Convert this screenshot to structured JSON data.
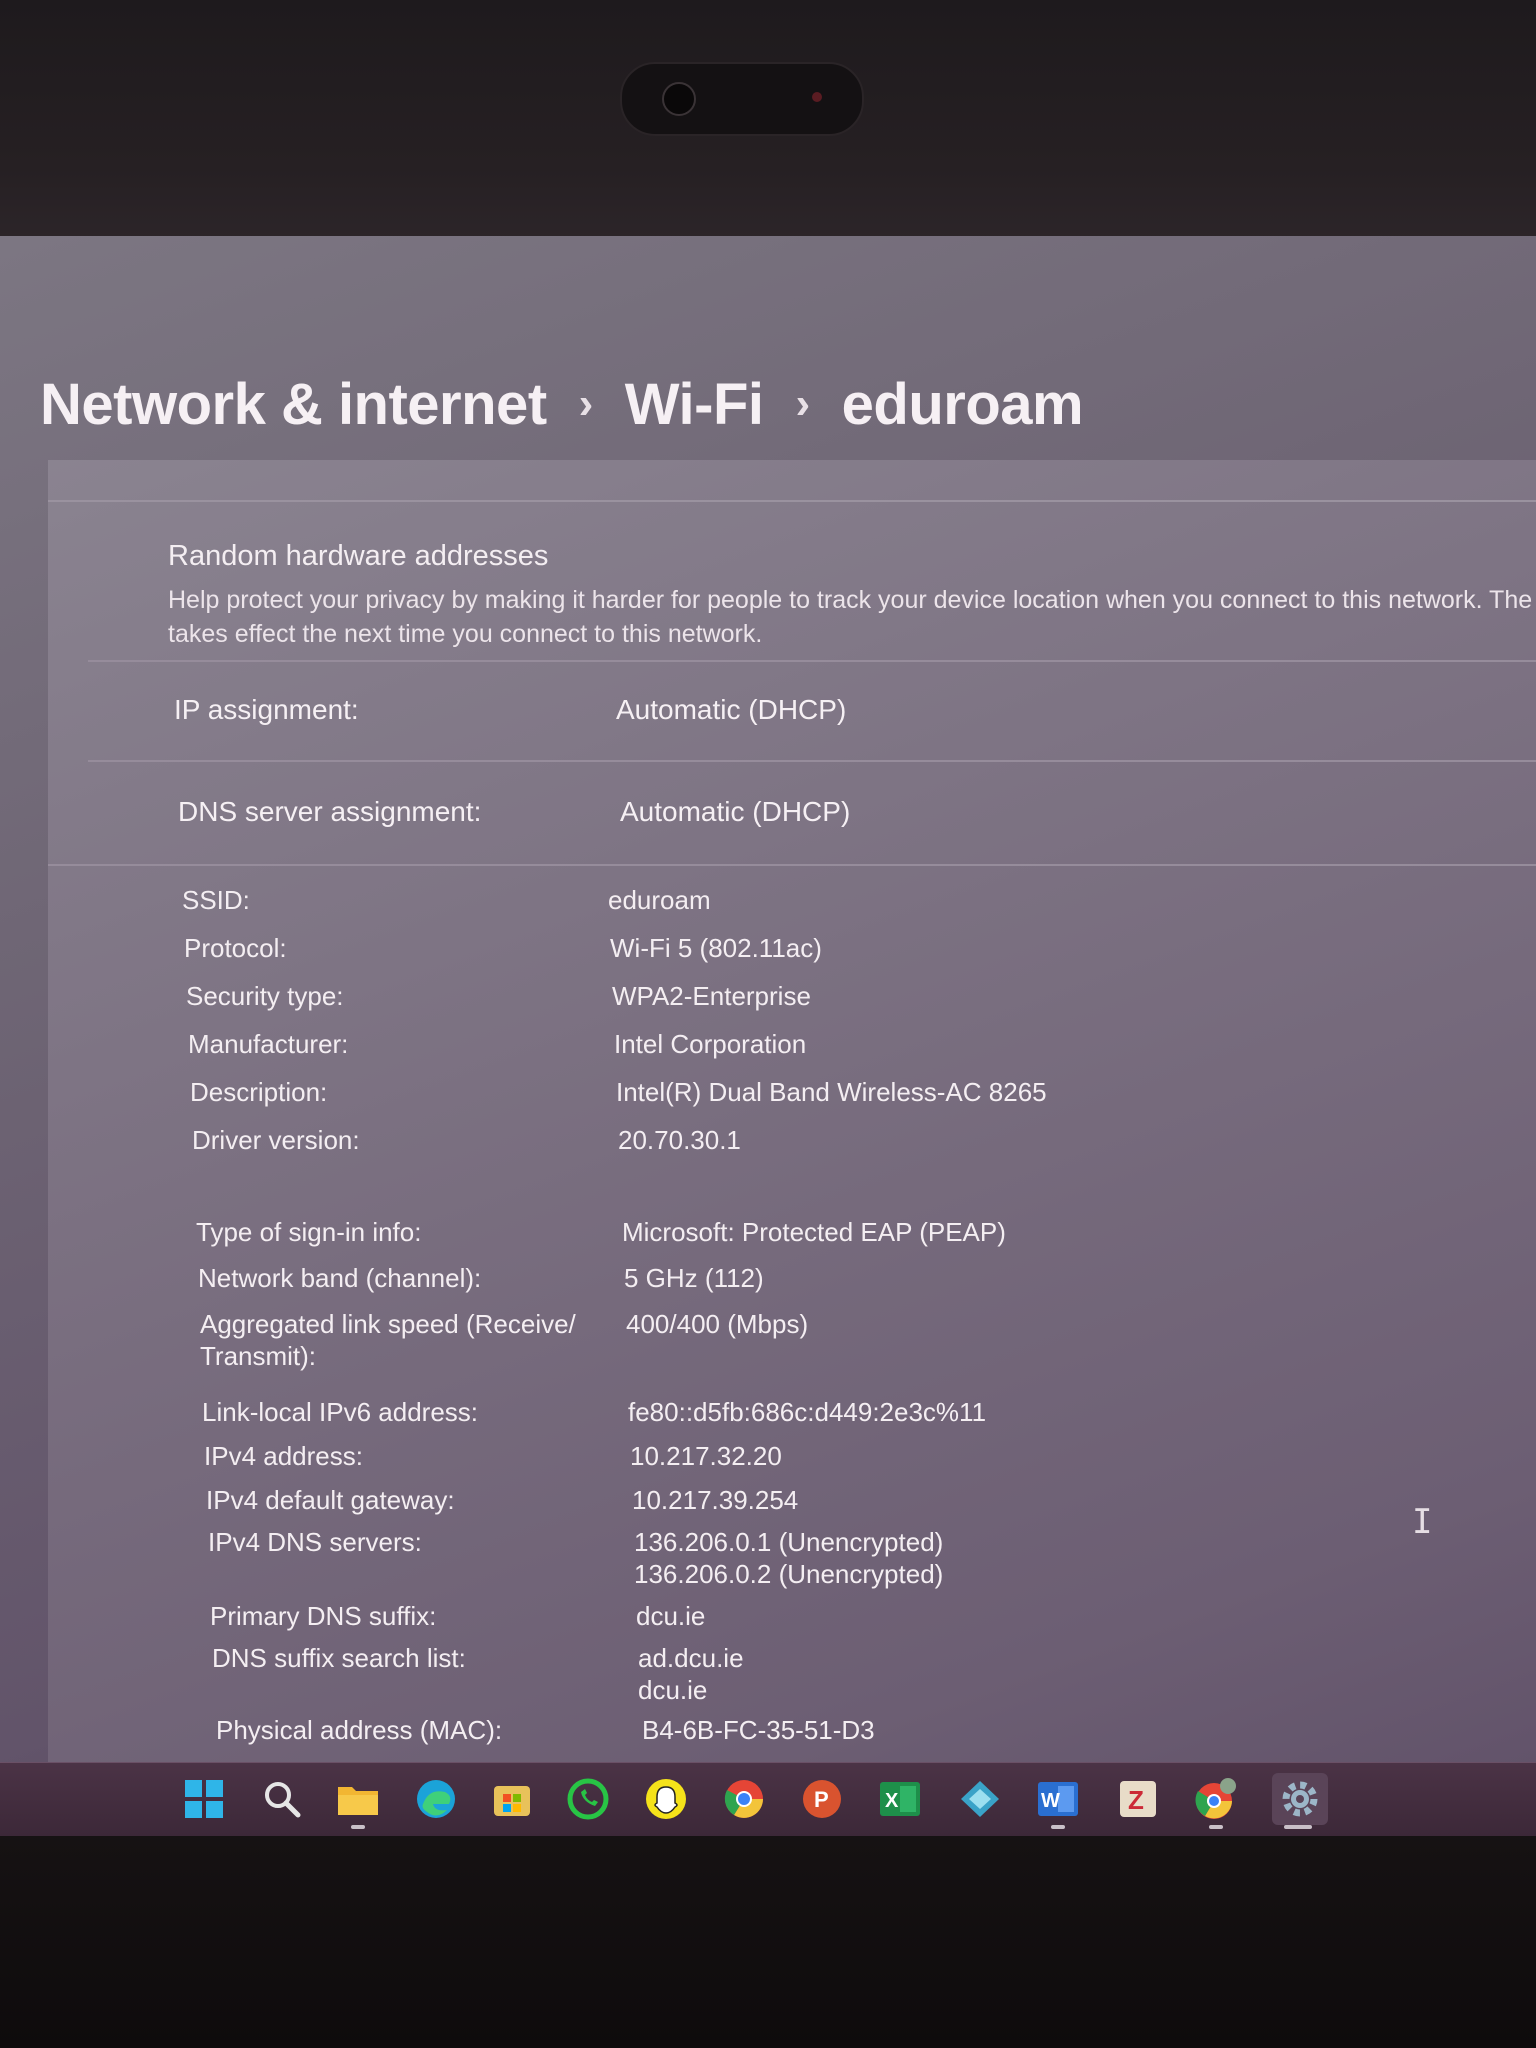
{
  "breadcrumb": {
    "level1": "Network & internet",
    "level2": "Wi-Fi",
    "current": "eduroam",
    "separator": "›"
  },
  "privacy": {
    "title": "Random hardware addresses",
    "description_line1": "Help protect your privacy by making it harder for people to track your device location when you connect to this network. The",
    "description_line2": "takes effect the next time you connect to this network."
  },
  "assignment": {
    "ip_label": "IP assignment:",
    "ip_value": "Automatic (DHCP)",
    "dns_label": "DNS server assignment:",
    "dns_value": "Automatic (DHCP)"
  },
  "properties": [
    {
      "label": "SSID:",
      "value": "eduroam"
    },
    {
      "label": "Protocol:",
      "value": "Wi-Fi 5 (802.11ac)"
    },
    {
      "label": "Security type:",
      "value": "WPA2-Enterprise"
    },
    {
      "label": "Manufacturer:",
      "value": "Intel Corporation"
    },
    {
      "label": "Description:",
      "value": "Intel(R) Dual Band Wireless-AC 8265"
    },
    {
      "label": "Driver version:",
      "value": "20.70.30.1"
    },
    {
      "label": "Type of sign-in info:",
      "value": "Microsoft: Protected EAP (PEAP)"
    },
    {
      "label": "Network band (channel):",
      "value": "5 GHz (112)"
    },
    {
      "label": "Aggregated link speed (Receive/",
      "label_line2": "Transmit):",
      "value": "400/400 (Mbps)"
    },
    {
      "label": "Link-local IPv6 address:",
      "value": "fe80::d5fb:686c:d449:2e3c%11"
    },
    {
      "label": "IPv4 address:",
      "value": "10.217.32.20"
    },
    {
      "label": "IPv4 default gateway:",
      "value": "10.217.39.254"
    },
    {
      "label": "IPv4 DNS servers:",
      "value": "136.206.0.1 (Unencrypted)",
      "value_line2": "136.206.0.2 (Unencrypted)"
    },
    {
      "label": "Primary DNS suffix:",
      "value": "dcu.ie"
    },
    {
      "label": "DNS suffix search list:",
      "value": "ad.dcu.ie",
      "value_line2": "dcu.ie"
    },
    {
      "label": "Physical address (MAC):",
      "value": "B4-6B-FC-35-51-D3"
    }
  ],
  "taskbar": [
    {
      "name": "start-icon",
      "glyph": "",
      "color": "#2fb5e8"
    },
    {
      "name": "search-icon",
      "glyph": "",
      "color": "#e6e6e6"
    },
    {
      "name": "file-explorer-icon",
      "glyph": "",
      "color": "#f2b632"
    },
    {
      "name": "edge-icon",
      "glyph": "",
      "color": "#1ba3d8"
    },
    {
      "name": "store-icon",
      "glyph": "",
      "color": "#e8c25a"
    },
    {
      "name": "whatsapp-icon",
      "glyph": "",
      "color": "#28c445"
    },
    {
      "name": "snapchat-icon",
      "glyph": "",
      "color": "#f5e21a"
    },
    {
      "name": "chrome-icon",
      "glyph": "",
      "color": "#e54536"
    },
    {
      "name": "powerpoint-icon",
      "glyph": "P",
      "color": "#d9532f"
    },
    {
      "name": "excel-icon",
      "glyph": "X",
      "color": "#1e8f4a"
    },
    {
      "name": "app-diamond-icon",
      "glyph": "",
      "color": "#3aa3c8"
    },
    {
      "name": "word-icon",
      "glyph": "W",
      "color": "#2a6fd1"
    },
    {
      "name": "zotero-icon",
      "glyph": "Z",
      "color": "#e8dcc8"
    },
    {
      "name": "chrome-profile-icon",
      "glyph": "",
      "color": "#e54536"
    },
    {
      "name": "settings-icon",
      "glyph": "",
      "color": "#9cb6c8"
    }
  ]
}
